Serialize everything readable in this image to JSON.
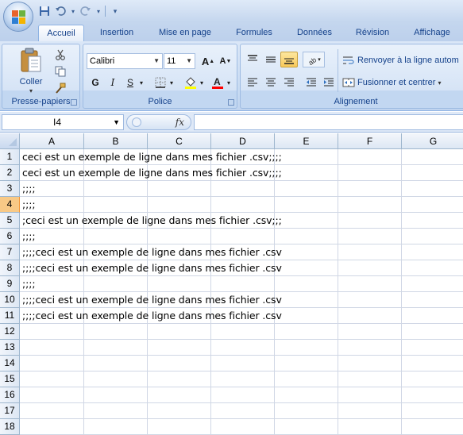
{
  "quick_access": {
    "icons": [
      "save-icon",
      "undo-icon",
      "redo-icon",
      "customize-icon"
    ]
  },
  "tabs": [
    "Accueil",
    "Insertion",
    "Mise en page",
    "Formules",
    "Données",
    "Révision",
    "Affichage"
  ],
  "active_tab": "Accueil",
  "ribbon": {
    "clipboard": {
      "label": "Presse-papiers",
      "paste_label": "Coller"
    },
    "font": {
      "label": "Police",
      "font_name": "Calibri",
      "font_size": "11",
      "bold": "G",
      "italic": "I",
      "underline": "S",
      "font_color": "#ff0000",
      "fill_color": "#ffff00"
    },
    "alignment": {
      "label": "Alignement",
      "wrap_text_label": "Renvoyer à la ligne autom",
      "merge_center_label": "Fusionner et centrer"
    }
  },
  "formula_bar": {
    "name_box": "I4",
    "fx_label": "fx",
    "formula": ""
  },
  "sheet": {
    "columns": [
      "A",
      "B",
      "C",
      "D",
      "E",
      "F",
      "G"
    ],
    "selected_row": 4,
    "rows": [
      {
        "num": "1",
        "a": "ceci est un exemple de ligne dans mes fichier .csv;;;;"
      },
      {
        "num": "2",
        "a": "ceci est un exemple de ligne dans mes fichier .csv;;;;"
      },
      {
        "num": "3",
        "a": ";;;;"
      },
      {
        "num": "4",
        "a": ";;;;"
      },
      {
        "num": "5",
        "a": ";ceci est un exemple de ligne dans mes fichier .csv;;;"
      },
      {
        "num": "6",
        "a": ";;;;"
      },
      {
        "num": "7",
        "a": ";;;;ceci est un exemple de ligne dans mes fichier .csv"
      },
      {
        "num": "8",
        "a": ";;;;ceci est un exemple de ligne dans mes fichier .csv"
      },
      {
        "num": "9",
        "a": ";;;;"
      },
      {
        "num": "10",
        "a": ";;;;ceci est un exemple de ligne dans mes fichier .csv"
      },
      {
        "num": "11",
        "a": ";;;;ceci est un exemple de ligne dans mes fichier .csv"
      },
      {
        "num": "12",
        "a": ""
      },
      {
        "num": "13",
        "a": ""
      },
      {
        "num": "14",
        "a": ""
      },
      {
        "num": "15",
        "a": ""
      },
      {
        "num": "16",
        "a": ""
      },
      {
        "num": "17",
        "a": ""
      },
      {
        "num": "18",
        "a": ""
      }
    ]
  }
}
